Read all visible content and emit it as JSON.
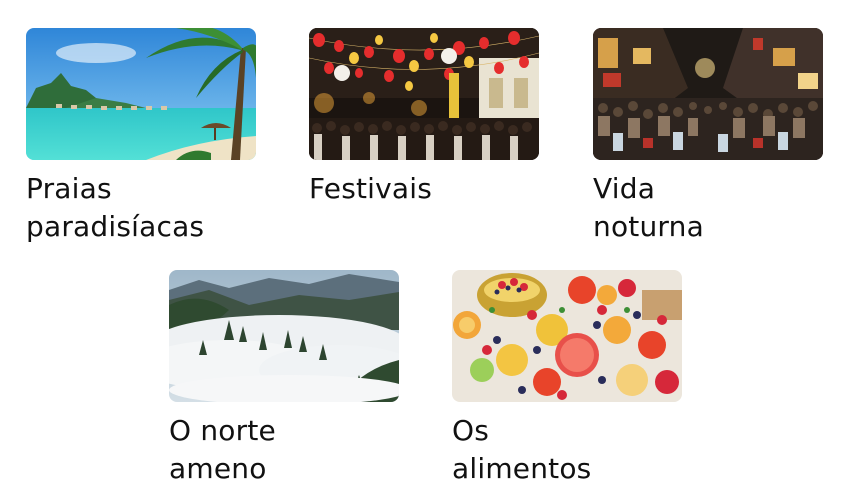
{
  "cards": [
    {
      "line1": "Praias",
      "line2": "paradisíacas",
      "image_icon": "tropical-beach-image"
    },
    {
      "line1": "Festivais",
      "line2": "",
      "image_icon": "lantern-festival-image"
    },
    {
      "line1": "Vida",
      "line2": "noturna",
      "image_icon": "night-street-image"
    },
    {
      "line1": "O norte",
      "line2": "ameno",
      "image_icon": "misty-mountains-image"
    },
    {
      "line1": "Os",
      "line2": "alimentos",
      "image_icon": "fruit-platter-image"
    }
  ]
}
